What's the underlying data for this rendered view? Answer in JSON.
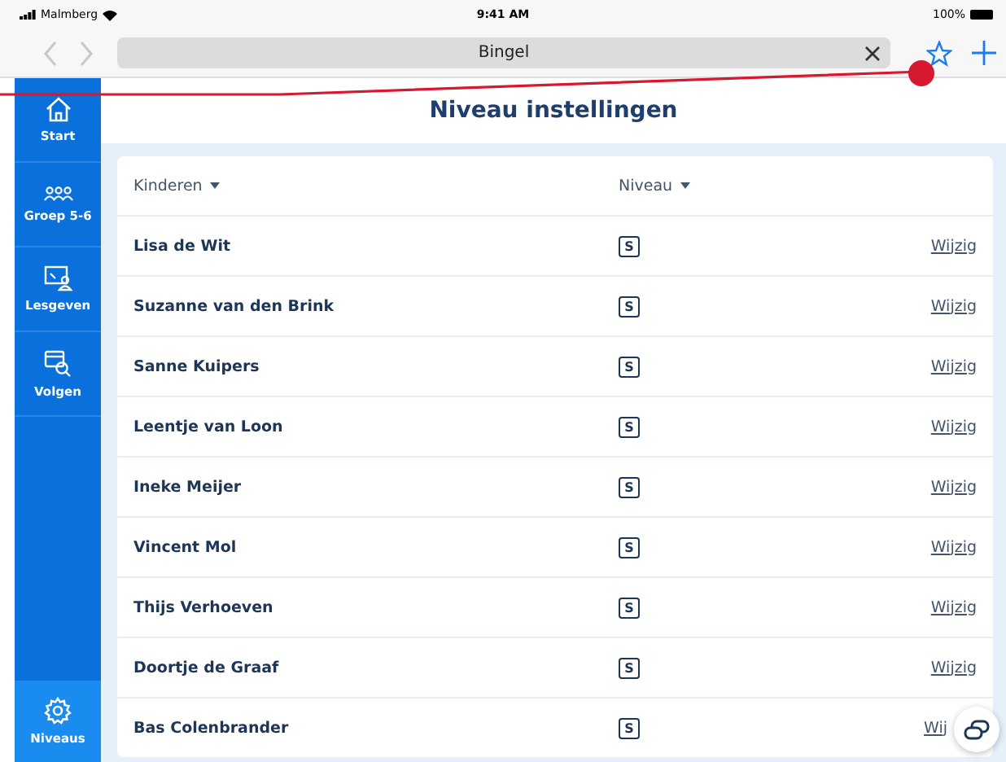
{
  "status_bar": {
    "carrier": "Malmberg",
    "time": "9:41 AM",
    "battery": "100%"
  },
  "browser": {
    "address": "Bingel"
  },
  "sidebar": {
    "items": [
      {
        "label": "Start",
        "selected": false
      },
      {
        "label": "Groep 5-6",
        "selected": false
      },
      {
        "label": "Lesgeven",
        "selected": false
      },
      {
        "label": "Volgen",
        "selected": false
      }
    ],
    "bottom_item": {
      "label": "Niveaus",
      "selected": true
    }
  },
  "page": {
    "title": "Niveau instellingen"
  },
  "table": {
    "columns": [
      "Kinderen",
      "Niveau"
    ],
    "rows": [
      {
        "name": "Lisa de Wit",
        "level": "S",
        "action": "Wijzig"
      },
      {
        "name": "Suzanne van den Brink",
        "level": "S",
        "action": "Wijzig"
      },
      {
        "name": "Sanne Kuipers",
        "level": "S",
        "action": "Wijzig"
      },
      {
        "name": "Leentje van Loon",
        "level": "S",
        "action": "Wijzig"
      },
      {
        "name": "Ineke Meijer",
        "level": "S",
        "action": "Wijzig"
      },
      {
        "name": "Vincent Mol",
        "level": "S",
        "action": "Wijzig"
      },
      {
        "name": "Thijs Verhoeven",
        "level": "S",
        "action": "Wijzig"
      },
      {
        "name": "Doortje de Graaf",
        "level": "S",
        "action": "Wijzig"
      },
      {
        "name": "Bas Colenbrander",
        "level": "S",
        "action": "Wij"
      }
    ]
  }
}
